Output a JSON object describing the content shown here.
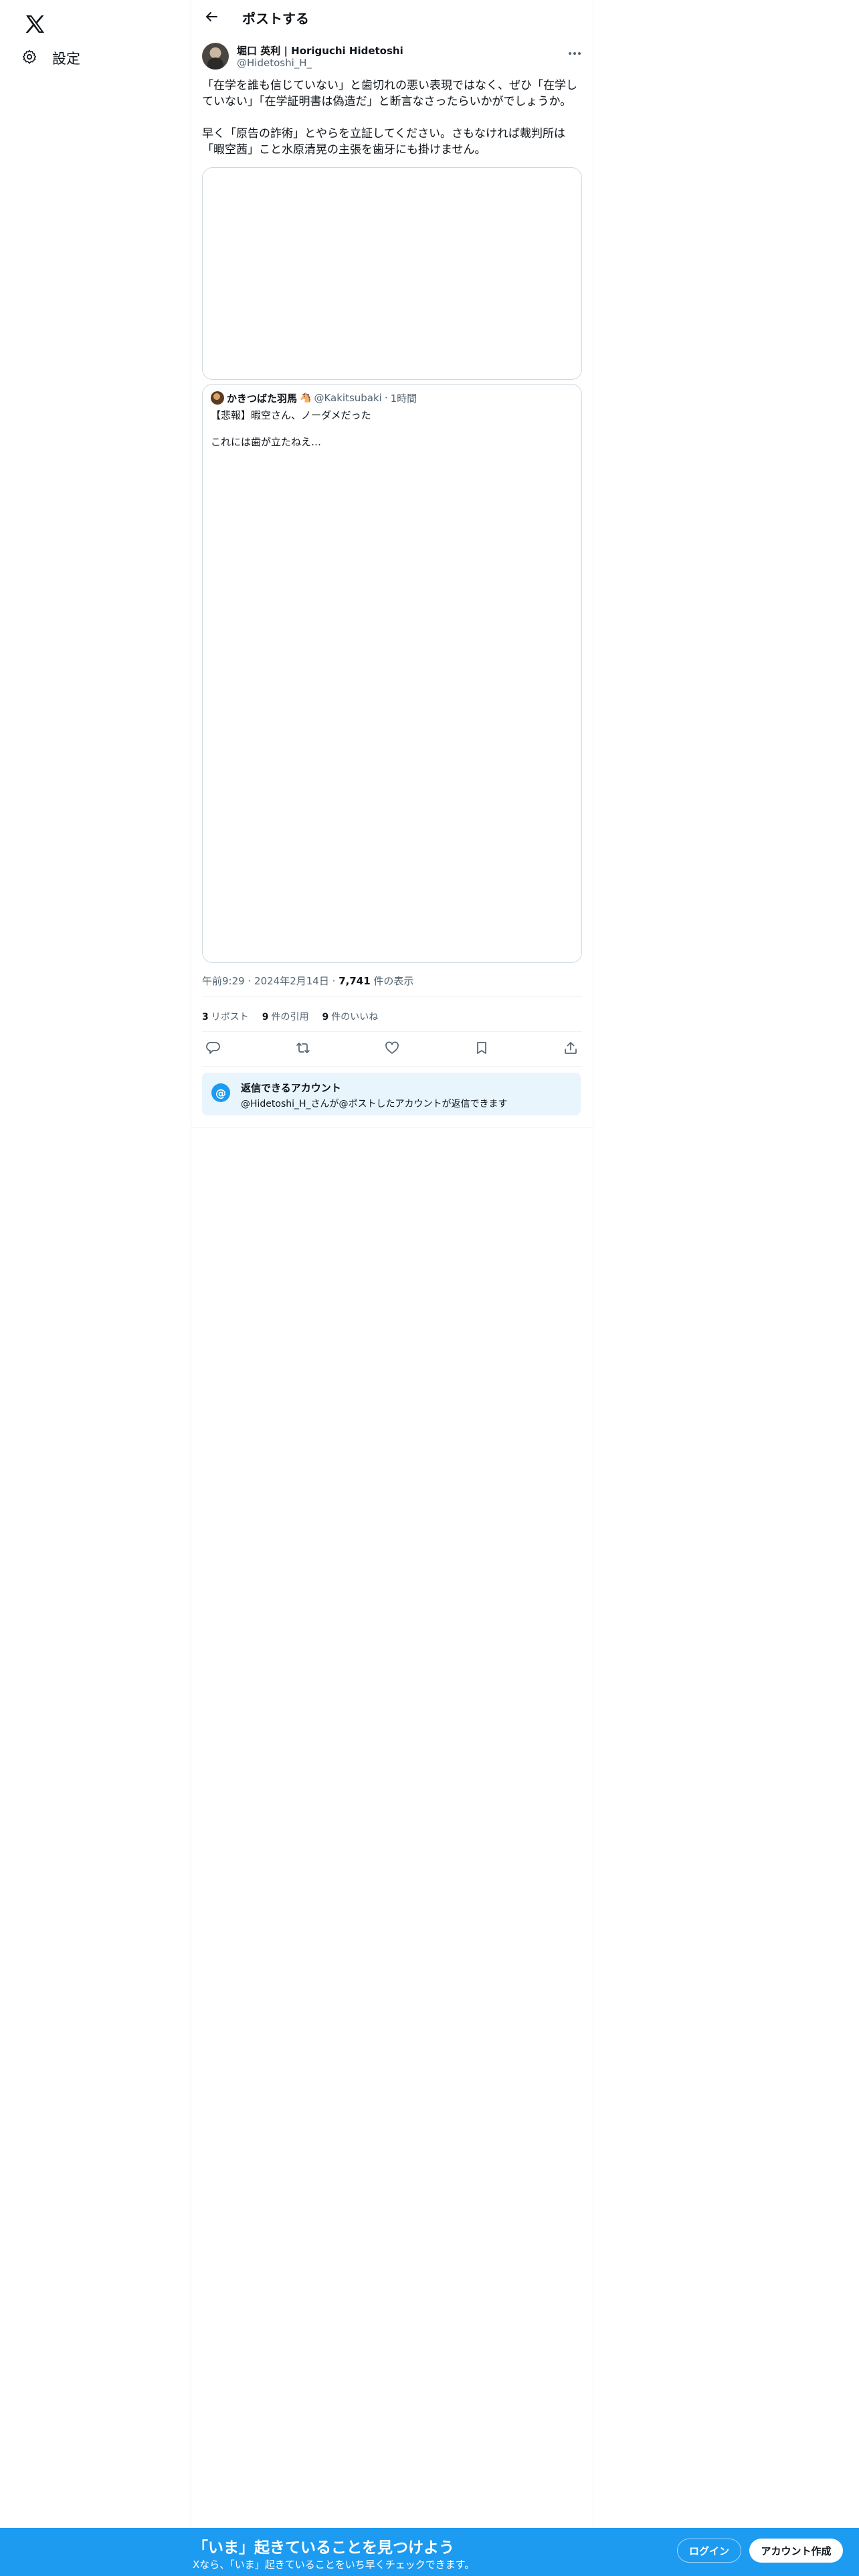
{
  "sidebar": {
    "logo_icon": "x-logo-icon",
    "settings_label": "設定"
  },
  "header": {
    "title": "ポストする"
  },
  "post": {
    "author_name": "堀口 英利 | Horiguchi Hidetoshi",
    "author_handle": "@Hidetoshi_H_",
    "text": "「在学を誰も信じていない」と歯切れの悪い表現ではなく、ぜひ「在学していない」「在学証明書は偽造だ」と断言なさったらいかがでしょうか。\n\n早く「原告の詐術」とやらを立証してください。さもなければ裁判所は「暇空茜」こと水原清晃の主張を歯牙にも掛けません。",
    "time": "午前9:29",
    "date": "2024年2月14日",
    "views_count": "7,741",
    "views_label": "件の表示",
    "separator": "·"
  },
  "quote": {
    "author_name": "かきつばた羽馬",
    "emoji": "🐴",
    "author_handle": "@Kakitsubaki",
    "separator": "·",
    "time": "1時間",
    "text": "【悲報】暇空さん、ノーダメだった\n\nこれには歯が立たねえ…"
  },
  "stats": [
    {
      "count": "3",
      "label": "リポスト"
    },
    {
      "count": "9",
      "label": "件の引用"
    },
    {
      "count": "9",
      "label": "件のいいね"
    }
  ],
  "reply_restriction": {
    "title": "返信できるアカウント",
    "description": "@Hidetoshi_H_さんが@ポストしたアカウントが返信できます",
    "icon_glyph": "@"
  },
  "banner": {
    "title": "「いま」起きていることを見つけよう",
    "subtitle": "Xなら、「いま」起きていることをいち早くチェックできます。",
    "login_label": "ログイン",
    "signup_label": "アカウント作成"
  },
  "colors": {
    "accent": "#1d9bf0",
    "text_primary": "#0f1419",
    "text_secondary": "#536471",
    "border": "#cfd9de",
    "reply_box_bg": "#e8f5fd"
  }
}
